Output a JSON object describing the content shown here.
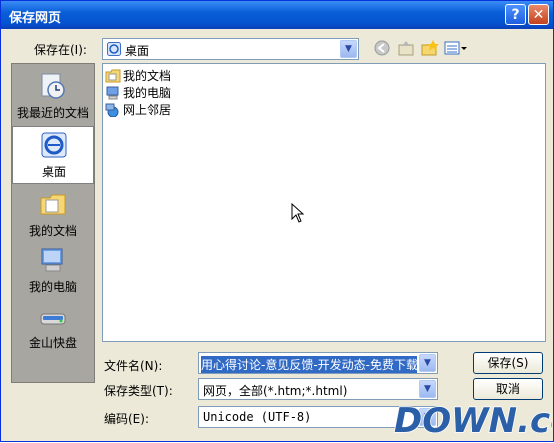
{
  "window": {
    "title": "保存网页",
    "help_label": "?",
    "close_label": "✕"
  },
  "save_in": {
    "label": "保存在(I):",
    "value": "桌面"
  },
  "places": [
    {
      "label": "我最近的文档",
      "icon": "recent-docs-icon"
    },
    {
      "label": "桌面",
      "icon": "desktop-icon"
    },
    {
      "label": "我的文档",
      "icon": "my-documents-icon"
    },
    {
      "label": "我的电脑",
      "icon": "my-computer-icon"
    },
    {
      "label": "金山快盘",
      "icon": "kuaipan-drive-icon"
    }
  ],
  "files": [
    {
      "name": "我的文档",
      "icon": "my-documents-icon"
    },
    {
      "name": "我的电脑",
      "icon": "my-computer-icon"
    },
    {
      "name": "网上邻居",
      "icon": "network-places-icon"
    }
  ],
  "filename": {
    "label": "文件名(N):",
    "value": "用心得讨论-意见反馈-开发动态-免费下载"
  },
  "filetype": {
    "label": "保存类型(T):",
    "value": "网页，全部(*.htm;*.html)"
  },
  "encoding": {
    "label": "编码(E):",
    "value": "Unicode (UTF-8)"
  },
  "buttons": {
    "save": "保存(S)",
    "cancel": "取消"
  },
  "watermark": {
    "text": "DOWN.cc"
  },
  "colors": {
    "titlebar": "#0a5fd8",
    "places_bg": "#a7a6a1",
    "selection": "#316ac5",
    "watermark": "#2b5fa8"
  }
}
